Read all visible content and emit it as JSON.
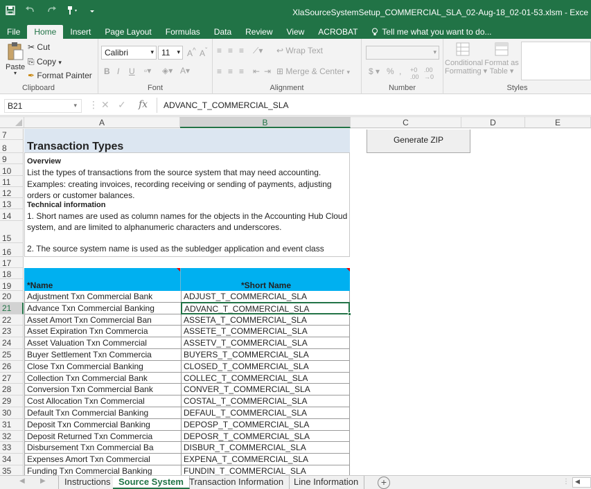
{
  "window_title": "XlaSourceSystemSetup_COMMERCIAL_SLA_02-Aug-18_02-01-53.xlsm - Exce",
  "qat": {
    "save_icon": "save-icon",
    "undo_icon": "undo-icon",
    "redo_icon": "redo-icon",
    "marker_icon": "format-painter-qat-icon"
  },
  "menu": {
    "items": [
      "File",
      "Home",
      "Insert",
      "Page Layout",
      "Formulas",
      "Data",
      "Review",
      "View",
      "ACROBAT"
    ],
    "active": "Home",
    "tell_me": "Tell me what you want to do..."
  },
  "ribbon": {
    "clipboard": {
      "paste": "Paste",
      "cut": "Cut",
      "copy": "Copy",
      "format_painter": "Format Painter",
      "label": "Clipboard"
    },
    "font": {
      "name": "Calibri",
      "size": "11",
      "label": "Font",
      "bold": "B",
      "italic": "I",
      "underline": "U"
    },
    "alignment": {
      "wrap_text": "Wrap Text",
      "merge_center": "Merge & Center",
      "label": "Alignment"
    },
    "number": {
      "format": "",
      "currency": "$",
      "percent": "%",
      "comma": ",",
      "label": "Number"
    },
    "styles": {
      "conditional": "Conditional Formatting",
      "conditional_l1": "Conditional",
      "conditional_l2": "Formatting",
      "format_as_table_l1": "Format as",
      "format_as_table_l2": "Table",
      "label": "Styles"
    }
  },
  "formula_bar": {
    "name_box": "B21",
    "fx": "fx",
    "formula": "ADVANC_T_COMMERCIAL_SLA"
  },
  "columns": [
    "A",
    "B",
    "C",
    "D",
    "E"
  ],
  "sheet": {
    "rows_top": [
      "7",
      "8",
      "9",
      "10",
      "11",
      "12",
      "13",
      "14",
      "15",
      "16",
      "17",
      "18",
      "19"
    ],
    "section_title": "Transaction Types",
    "overview_heading": "Overview",
    "overview_text": "List the types of transactions from the source system that may need accounting.",
    "examples_line1": "Examples: creating invoices, recording receiving or sending of payments, adjusting",
    "examples_line2": "orders or customer balances.",
    "technical_heading": "Technical information",
    "technical_line1": "1. Short names are used as column names for the objects in the Accounting Hub Cloud",
    "technical_line2": "system, and are limited to alphanumeric characters and underscores.",
    "technical_line3": "2. The source system name is used as the subledger application and event class",
    "generate_zip": "Generate ZIP",
    "header_name": "*Name",
    "header_short": "*Short Name",
    "data_rows": [
      {
        "row": "20",
        "name": "Adjustment Txn Commercial Bank",
        "short": "ADJUST_T_COMMERCIAL_SLA"
      },
      {
        "row": "21",
        "name": "Advance Txn Commercial Banking",
        "short": "ADVANC_T_COMMERCIAL_SLA"
      },
      {
        "row": "22",
        "name": "Asset Amort Txn Commercial Ban",
        "short": "ASSETA_T_COMMERCIAL_SLA"
      },
      {
        "row": "23",
        "name": "Asset Expiration Txn Commercia",
        "short": "ASSETE_T_COMMERCIAL_SLA"
      },
      {
        "row": "24",
        "name": "Asset Valuation Txn Commercial",
        "short": "ASSETV_T_COMMERCIAL_SLA"
      },
      {
        "row": "25",
        "name": "Buyer Settlement Txn Commercia",
        "short": "BUYERS_T_COMMERCIAL_SLA"
      },
      {
        "row": "26",
        "name": "Close Txn Commercial Banking",
        "short": "CLOSED_T_COMMERCIAL_SLA"
      },
      {
        "row": "27",
        "name": "Collection Txn Commercial Bank",
        "short": "COLLEC_T_COMMERCIAL_SLA"
      },
      {
        "row": "28",
        "name": "Conversion Txn Commercial Bank",
        "short": "CONVER_T_COMMERCIAL_SLA"
      },
      {
        "row": "29",
        "name": "Cost Allocation Txn Commercial",
        "short": "COSTAL_T_COMMERCIAL_SLA"
      },
      {
        "row": "30",
        "name": "Default Txn Commercial Banking",
        "short": "DEFAUL_T_COMMERCIAL_SLA"
      },
      {
        "row": "31",
        "name": "Deposit Txn Commercial Banking",
        "short": "DEPOSP_T_COMMERCIAL_SLA"
      },
      {
        "row": "32",
        "name": "Deposit Returned Txn Commercia",
        "short": "DEPOSR_T_COMMERCIAL_SLA"
      },
      {
        "row": "33",
        "name": "Disbursement Txn Commercial Ba",
        "short": "DISBUR_T_COMMERCIAL_SLA"
      },
      {
        "row": "34",
        "name": "Expenses Amort Txn Commercial",
        "short": "EXPENA_T_COMMERCIAL_SLA"
      },
      {
        "row": "35",
        "name": "Funding Txn Commercial Banking",
        "short": "FUNDIN_T_COMMERCIAL_SLA"
      }
    ]
  },
  "tabs": [
    "Instructions",
    "Source System",
    "Transaction Information",
    "Line Information"
  ],
  "active_tab": "Source System",
  "add_sheet": "+",
  "colors": {
    "excel_green": "#217346",
    "header_cyan": "#00b0f0",
    "title_band": "#dce6f1",
    "selected_green": "#217346"
  }
}
